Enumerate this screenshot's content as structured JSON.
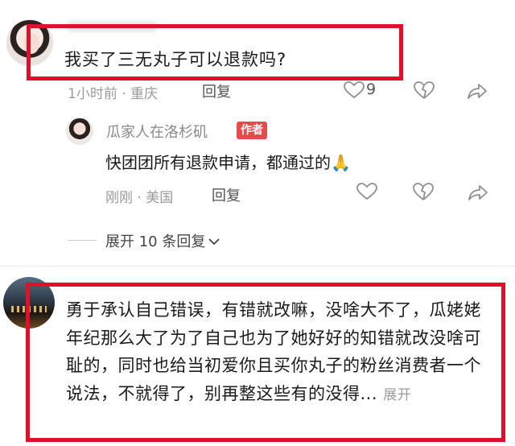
{
  "comment1": {
    "text": "我买了三无丸子可以退款吗?",
    "meta": "1小时前 · 重庆",
    "reply_label": "回复",
    "like_count": "9"
  },
  "author_reply": {
    "name": "瓜家人在洛杉矶",
    "badge": "作者",
    "text": "快团团所有退款申请，都通过的",
    "emoji": "🙏",
    "meta": "刚刚 · 美国",
    "reply_label": "回复"
  },
  "expand_replies": "展开 10 条回复",
  "comment2": {
    "text": "勇于承认自己错误，有错就改嘛，没啥大不了，瓜姥姥年纪那么大了为了自己也为了她好好的知错就改没啥可耻的，同时也给当初爱你且买你丸子的粉丝消费者一个说法，不就得了，别再整这些有的没得...",
    "more": "展开"
  },
  "colors": {
    "highlight_box": "#e0102a",
    "author_badge": "#e64b4b"
  }
}
